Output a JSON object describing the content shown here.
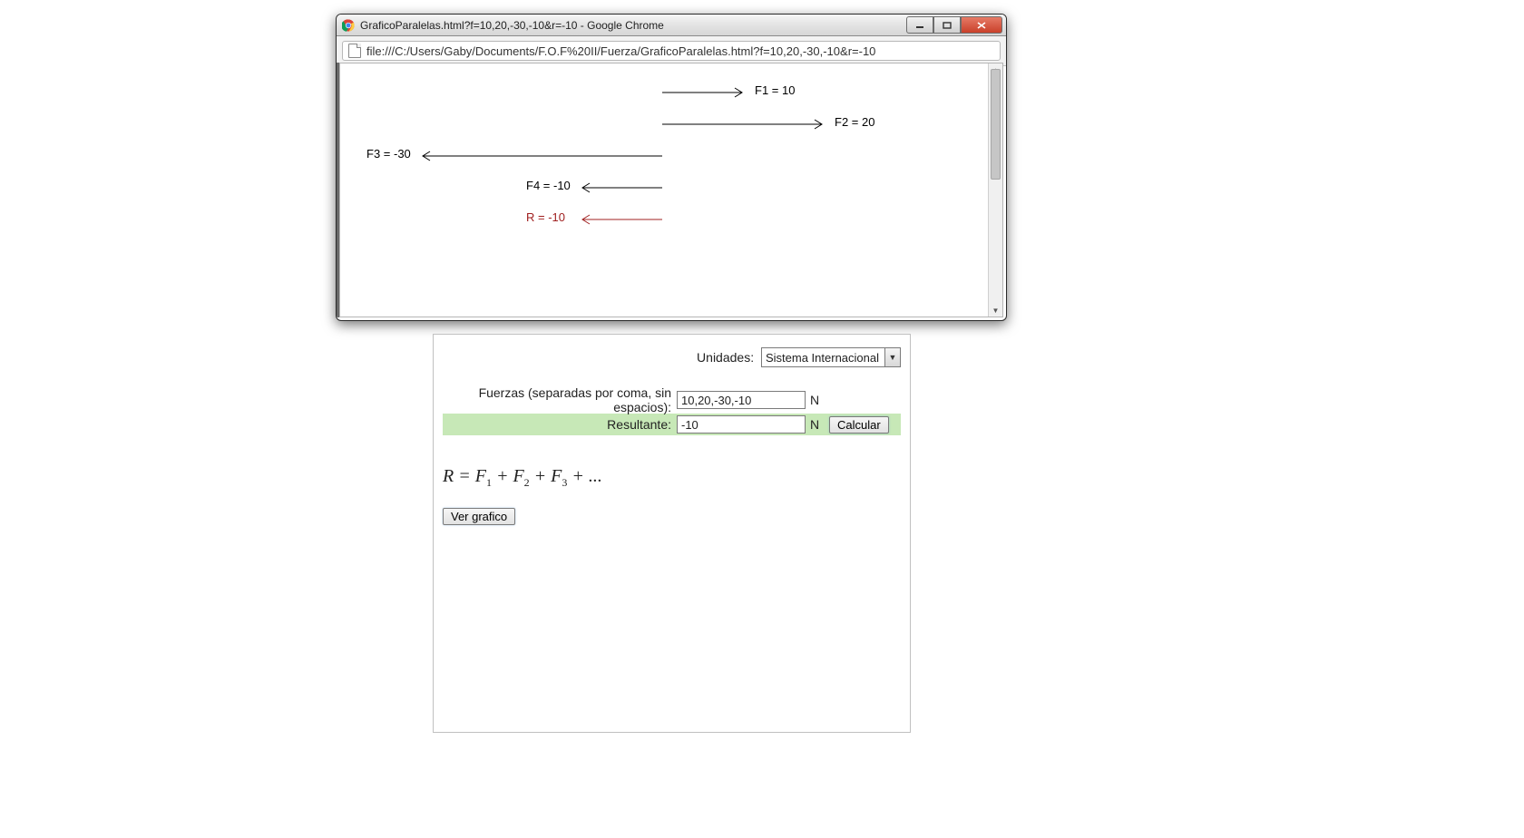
{
  "window": {
    "title": "GraficoParalelas.html?f=10,20,-30,-10&r=-10 - Google Chrome",
    "url": "file:///C:/Users/Gaby/Documents/F.O.F%20II/Fuerza/GraficoParalelas.html?f=10,20,-30,-10&r=-10"
  },
  "chart_data": {
    "type": "vector",
    "unit": "N",
    "axis_origin": 0,
    "pixels_per_unit": 8.8,
    "forces": [
      {
        "name": "F1",
        "value": 10,
        "label": "F1 = 10",
        "color": "#000000"
      },
      {
        "name": "F2",
        "value": 20,
        "label": "F2 = 20",
        "color": "#000000"
      },
      {
        "name": "F3",
        "value": -30,
        "label": "F3 = -30",
        "color": "#000000"
      },
      {
        "name": "F4",
        "value": -10,
        "label": "F4 = -10",
        "color": "#000000"
      },
      {
        "name": "R",
        "value": -10,
        "label": "R = -10",
        "color": "#a02020",
        "is_resultant": true
      }
    ]
  },
  "calc": {
    "units_label": "Unidades:",
    "units_value": "Sistema Internacional",
    "forces_label": "Fuerzas (separadas por coma, sin espacios):",
    "forces_value": "10,20,-30,-10",
    "result_label": "Resultante:",
    "result_value": "-10",
    "unit_symbol": "N",
    "calc_button": "Calcular",
    "formula_html": "R = F₁ + F₂ + F₃ + ...",
    "graph_button": "Ver grafico"
  }
}
